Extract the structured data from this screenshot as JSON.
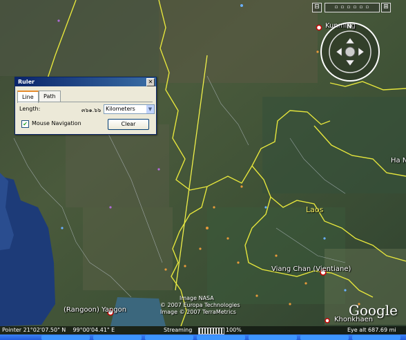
{
  "map": {
    "labels": {
      "kunming": "Kunming",
      "laos": "Laos",
      "vientiane": "Viang Chan (Vientiane)",
      "yangon": "(Rangoon) Yangon",
      "khonkhaen": "Khonkhaen",
      "ha_n": "Ha N"
    },
    "credits": [
      "Image NASA",
      "© 2007 Europa Technologies",
      "Image © 2007 TerraMetrics"
    ],
    "logo": "Google",
    "border_color": "#e6e63c",
    "ruler_line_color": "#f0f04a"
  },
  "ruler": {
    "title": "Ruler",
    "tabs": [
      "Line",
      "Path"
    ],
    "active_tab": "Line",
    "length_label": "Length:",
    "length_value": "๓๖๑.๖๖",
    "unit": "Kilometers",
    "mouse_navigation_label": "Mouse Navigation",
    "mouse_navigation_checked": true,
    "clear_label": "Clear"
  },
  "status": {
    "pointer": "Pointer 21°02'07.50\" N    99°00'04.41\" E",
    "streaming": "Streaming",
    "streaming_percent": "100%",
    "eye_alt": "Eye alt  687.69 mi"
  }
}
